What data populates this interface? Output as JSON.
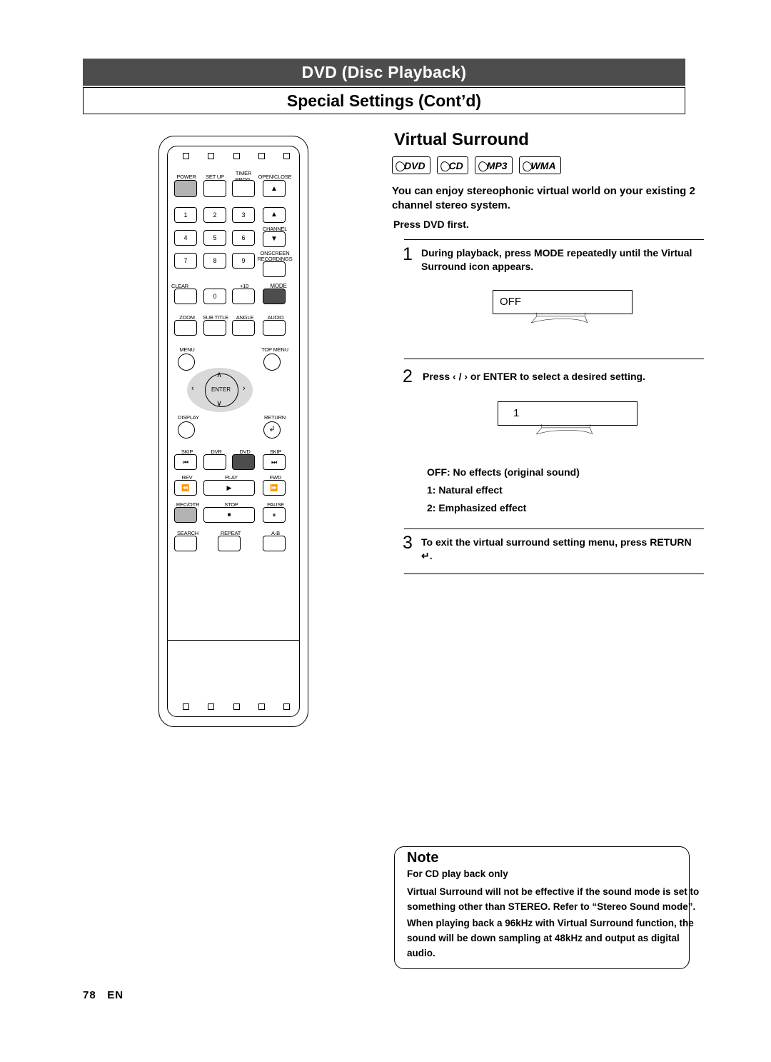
{
  "header": {
    "band_title": "DVD (Disc Playback)",
    "sub_title": "Special Settings (Cont’d)"
  },
  "section": {
    "title": "Virtual Surround",
    "logos": [
      "DVD",
      "CD",
      "MP3",
      "WMA"
    ],
    "intro": "You can enjoy stereophonic virtual world on your existing 2 channel stereo system.",
    "press_first": "Press DVD first."
  },
  "steps": [
    {
      "num": "1",
      "text": "During playback, press MODE repeatedly until the Virtual Surround icon appears."
    },
    {
      "num": "2",
      "text": "Press ‹ / › or ENTER to select a desired setting."
    },
    {
      "num": "3",
      "text": "To exit the virtual surround setting menu, press RETURN ↵."
    }
  ],
  "osd": {
    "first_value": "OFF",
    "second_value": "1"
  },
  "options": [
    "OFF: No effects (original sound)",
    "1: Natural effect",
    "2: Emphasized effect"
  ],
  "note": {
    "title": "Note",
    "subtitle": "For CD play back only",
    "lines": [
      "Virtual Surround will not be effective if the sound mode is set to something other than STEREO. Refer to “Stereo Sound mode”.",
      "When playing back a 96kHz with Virtual Surround function, the sound will be down sampling at 48kHz and output as digital audio."
    ]
  },
  "page": {
    "number": "78",
    "lang": "EN"
  },
  "remote": {
    "labels": {
      "power": "POWER",
      "setup": "SET UP",
      "timer_prog_1": "TIMER",
      "timer_prog_2": "PROG.",
      "open_close": "OPEN/CLOSE",
      "channel": "CHANNEL",
      "rec_1": "ONSCREEN",
      "rec_2": "RECORDINGS",
      "clear": "CLEAR",
      "plus10": "+10",
      "mode": "MODE",
      "zoom": "ZOOM",
      "subtitle": "SUB TITLE",
      "angle": "ANGLE",
      "audio": "AUDIO",
      "menu": "MENU",
      "top_menu": "TOP MENU",
      "enter": "ENTER",
      "display": "DISPLAY",
      "return": "RETURN",
      "skip_l": "SKIP",
      "dvr": "DVR",
      "dvd": "DVD",
      "skip_r": "SKIP",
      "rev": "REV",
      "play": "PLAY",
      "fwd": "FWD",
      "rec_otr": "REC/OTR",
      "stop": "STOP",
      "pause": "PAUSE",
      "search": "SEARCH",
      "repeat": "REPEAT",
      "ab": "A-B"
    },
    "numbers": [
      "1",
      "2",
      "3",
      "4",
      "5",
      "6",
      "7",
      "8",
      "9",
      "0"
    ]
  }
}
